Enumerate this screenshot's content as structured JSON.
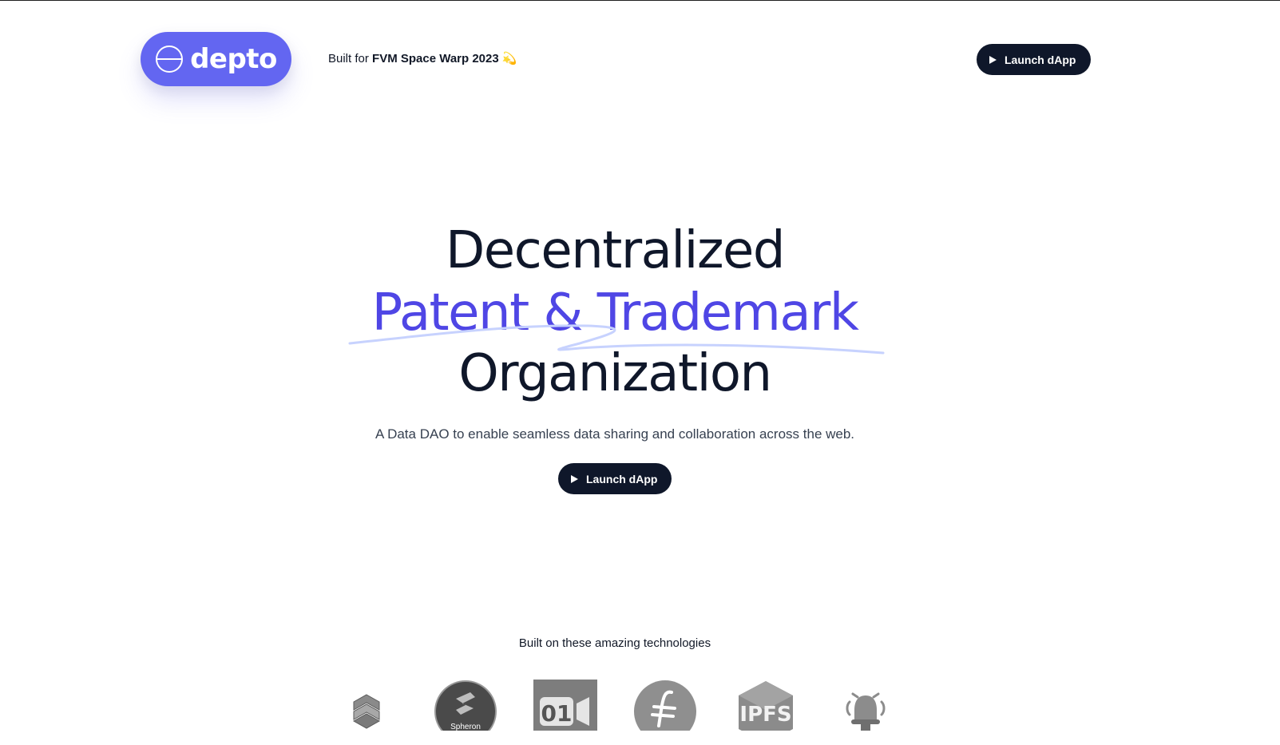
{
  "header": {
    "logo_text": "depto",
    "built_for_prefix": "Built for",
    "built_for_event": "FVM Space Warp 2023",
    "built_for_emoji": "💫",
    "launch_label": "Launch dApp"
  },
  "hero": {
    "line1": "Decentralized",
    "line2": "Patent & Trademark",
    "line3": "Organization",
    "subtitle": "A Data DAO to enable seamless data sharing and collaboration across the web.",
    "launch_label": "Launch dApp",
    "accent_color": "#4f46e5",
    "scribble_color": "#c7d2fe"
  },
  "technologies": {
    "title": "Built on these amazing technologies",
    "items": [
      {
        "icon": "polybase-icon"
      },
      {
        "icon": "spheron-icon",
        "label": "Spheron"
      },
      {
        "icon": "huddle01-icon",
        "label": "01"
      },
      {
        "icon": "filecoin-icon"
      },
      {
        "icon": "ipfs-icon",
        "label": "IPFS"
      },
      {
        "icon": "push-bell-icon"
      }
    ]
  },
  "colors": {
    "brand": "#6366f1",
    "dark": "#0f172a"
  }
}
